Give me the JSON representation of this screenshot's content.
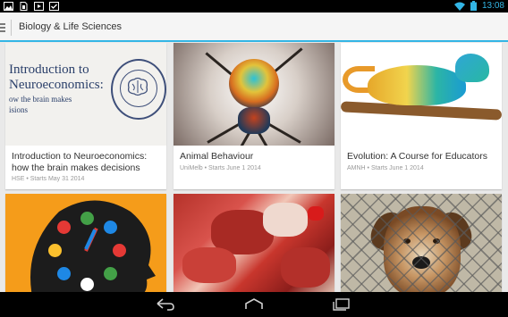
{
  "status_bar": {
    "time": "13:08",
    "left_icons": [
      "image-icon",
      "sim-icon",
      "video-icon",
      "check-icon"
    ],
    "right_icons": [
      "wifi-icon",
      "battery-icon"
    ]
  },
  "action_bar": {
    "title": "Biology & Life Sciences"
  },
  "colors": {
    "accent": "#33b5e5",
    "status_bar": "#000000",
    "nav_bar": "#000000"
  },
  "cards": [
    {
      "image_caption_line1": "Introduction to",
      "image_caption_line2": "Neuroeconomics:",
      "image_caption_line3": "ow the brain makes",
      "image_caption_line4": "isions",
      "title": "Introduction to Neuroeconomics: how the brain makes decisions",
      "subtitle": "HSE • Starts May 31 2014"
    },
    {
      "title": "Animal Behaviour",
      "subtitle": "UniMelb • Starts June 1 2014"
    },
    {
      "title": "Evolution: A Course for Educators",
      "subtitle": "AMNH • Starts June 1 2014"
    },
    {
      "title": "",
      "subtitle": ""
    },
    {
      "title": "",
      "subtitle": ""
    },
    {
      "title": "",
      "subtitle": ""
    }
  ],
  "nav_bar": {
    "buttons": [
      "back-icon",
      "home-icon",
      "recents-icon"
    ]
  }
}
